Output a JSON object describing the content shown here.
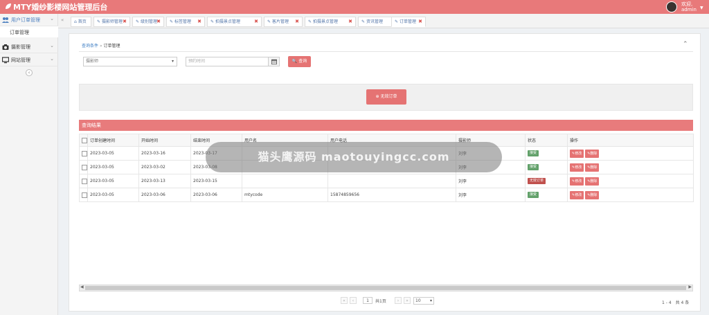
{
  "header": {
    "title": "MTY婚纱影楼网站管理后台",
    "user_greeting": "欢迎,",
    "user_name": "admin"
  },
  "sidebar": {
    "items": [
      {
        "label": "用户订单管理",
        "icon": "users-icon"
      },
      {
        "label": "摄影管理",
        "icon": "camera-icon"
      },
      {
        "label": "网站管理",
        "icon": "monitor-icon"
      }
    ],
    "sub_items": [
      {
        "label": "订单管理"
      }
    ]
  },
  "tabs": [
    {
      "label": "首页",
      "closable": false
    },
    {
      "label": "摄影师管理",
      "closable": true
    },
    {
      "label": "级别管理",
      "closable": true
    },
    {
      "label": "标签管理",
      "closable": true
    },
    {
      "label": "拍摄景点管理",
      "closable": true
    },
    {
      "label": "客片管理",
      "closable": true
    },
    {
      "label": "拍摄景点管理",
      "closable": true
    },
    {
      "label": "资讯管理",
      "closable": true
    },
    {
      "label": "订单管理",
      "closable": true,
      "active": true
    }
  ],
  "breadcrumb": {
    "root": "查询条件",
    "separator": "»",
    "current": "订单管理"
  },
  "filters": {
    "photographer_placeholder": "摄影师",
    "date_placeholder": "预约时间",
    "search_label": "查询"
  },
  "add_button_label": "无效订单",
  "results": {
    "heading": "查询结果",
    "columns": [
      "订单创建时间",
      "开始时间",
      "结束时间",
      "用户名",
      "用户电话",
      "摄影师",
      "状态",
      "操作"
    ],
    "rows": [
      {
        "created": "2023-03-05",
        "start": "2023-03-16",
        "end": "2023-03-17",
        "user": "",
        "phone": "",
        "photographer": "刘李",
        "status": "接受",
        "status_color": "#62a16a"
      },
      {
        "created": "2023-03-05",
        "start": "2023-03-02",
        "end": "2023-03-08",
        "user": "",
        "phone": "",
        "photographer": "刘李",
        "status": "接受",
        "status_color": "#62a16a"
      },
      {
        "created": "2023-03-05",
        "start": "2023-03-13",
        "end": "2023-03-15",
        "user": "",
        "phone": "",
        "photographer": "刘李",
        "status": "无效订单",
        "status_color": "#c0504d"
      },
      {
        "created": "2023-03-05",
        "start": "2023-03-06",
        "end": "2023-03-06",
        "user": "mtycode",
        "phone": "15874859656",
        "photographer": "刘李",
        "status": "接受",
        "status_color": "#62a16a"
      }
    ],
    "actions": [
      "修改",
      "删除"
    ]
  },
  "overlay_text": "猫头鹰源码 maotouyingcc.com",
  "pagination": {
    "current_page": "1",
    "total_pages_text": "共1页",
    "page_size": "10",
    "summary": "1 - 4　共 4 条"
  },
  "colors": {
    "accent": "#e8797a",
    "success": "#62a16a",
    "danger": "#c0504d"
  }
}
